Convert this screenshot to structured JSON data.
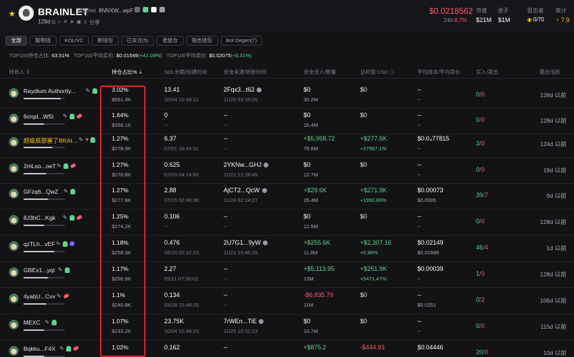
{
  "header": {
    "token_name": "BRAINLET",
    "token_sub": "Brainlet",
    "contract": "8NNXW...wpF",
    "age": "128d",
    "share_label": "分享",
    "price": "$0.0218562",
    "change_label": "24h",
    "change_value": "-8.7%",
    "stats": [
      {
        "label": "市值",
        "value": "$21M"
      },
      {
        "label": "池子",
        "value": "$1M"
      },
      {
        "label": "狙击者",
        "value": "0/70"
      },
      {
        "label": "审计",
        "value": "7.9"
      }
    ],
    "colors": {
      "accent": "#f5c518",
      "up": "#5fd38d",
      "down": "#ff5a6a"
    }
  },
  "tabs": [
    {
      "label": "全部",
      "active": true
    },
    {
      "label": "聪明钱"
    },
    {
      "label": "KOL/VC"
    },
    {
      "label": "新钱包"
    },
    {
      "label": "已关注(5)"
    },
    {
      "label": "老鼠仓"
    },
    {
      "label": "狙击钱包"
    },
    {
      "label": "Bot Degen(7)"
    }
  ],
  "top100": {
    "hold_label": "TOP100持仓占比:",
    "hold_value": "63.51%",
    "buy_label": "TOP100平均买价:",
    "buy_value": "$0.01549",
    "buy_change": "(+41.09%)",
    "sell_label": "TOP100平均卖价:",
    "sell_value": "$0.02075",
    "sell_change": "(+5.31%)"
  },
  "columns": {
    "holder": "持有人",
    "pct": "持仓占比%",
    "sol": "SOL余额/创建时间",
    "source": "资金来源/转账时间",
    "flow": "资金流入/数量",
    "pnl": "总利润 USD",
    "cost": "平均成本/平均卖价",
    "tx": "买入/卖出",
    "last": "最后活跃"
  },
  "rows": [
    {
      "name": "Raydium Authority...",
      "yellow": false,
      "bar": 0.9,
      "pct": "3.02%",
      "pct_sub": "$661.3K",
      "sol": "13.41",
      "sol_sub": "10/04 22:48:12",
      "src": "2Fqx3...t62",
      "src_sub": "11/25 03:16:05",
      "flow": "$0",
      "flow_sub": "30.2M",
      "flow_cls": "",
      "pnl": "$0",
      "pnl_sub": "",
      "pnl_cls": "",
      "cost": "--",
      "cost_sub": "--",
      "buy": "0",
      "sell": "0",
      "last": "128d 以前"
    },
    {
      "name": "6crqd...W5t",
      "yellow": false,
      "bar": 0.5,
      "pct": "1.64%",
      "pct_sub": "$358.1K",
      "sol": "0",
      "sol_sub": "--",
      "src": "--",
      "src_sub": "--",
      "flow": "$0",
      "flow_sub": "16.4M",
      "flow_cls": "",
      "pnl": "$0",
      "pnl_sub": "",
      "pnl_cls": "",
      "cost": "--",
      "cost_sub": "--",
      "buy": "0",
      "sell": "0",
      "last": "128d 以前"
    },
    {
      "name": "超级底部塞了BRAI...",
      "yellow": true,
      "bar": 0.7,
      "pct": "1.27%",
      "pct_sub": "$278.9K",
      "sol": "6.37",
      "sol_sub": "07/01 16:44:31",
      "src": "--",
      "src_sub": "--",
      "flow": "+$5,958.72",
      "flow_sub": "76.6M",
      "flow_cls": "g",
      "pnl": "+$277.5K",
      "pnl_sub": "+27987.1%",
      "pnl_cls": "g",
      "cost": "$0.0₄77815",
      "cost_sub": "--",
      "buy": "3",
      "sell": "0",
      "last": "124d 以前"
    },
    {
      "name": "2mLso...oeT",
      "yellow": false,
      "bar": 0.55,
      "pct": "1.27%",
      "pct_sub": "$278.8K",
      "sol": "0.625",
      "sol_sub": "07/03 04:14:50",
      "src": "2YKNw...GHJ",
      "src_sub": "11/21 12:28:45",
      "flow": "$0",
      "flow_sub": "12.7M",
      "flow_cls": "",
      "pnl": "$0",
      "pnl_sub": "",
      "pnl_cls": "",
      "cost": "--",
      "cost_sub": "--",
      "buy": "0",
      "sell": "0",
      "last": "19d 以前"
    },
    {
      "name": "GFzq6...QwZ",
      "yellow": false,
      "bar": 0.6,
      "pct": "1.27%",
      "pct_sub": "$277.8K",
      "sol": "2.88",
      "sol_sub": "07/15 02:48:36",
      "src": "AjCT2...QcW",
      "src_sub": "11/24 02:24:27",
      "flow": "+$29.6K",
      "flow_sub": "35.4M",
      "flow_cls": "g",
      "pnl": "+$271.9K",
      "pnl_sub": "+1950.89%",
      "pnl_cls": "g",
      "cost": "$0.00073",
      "cost_sub": "$0.0005",
      "buy": "39",
      "sell": "7",
      "last": "9d 以前"
    },
    {
      "name": "8J3hC...Kgk",
      "yellow": false,
      "bar": 0.5,
      "pct": "1.25%",
      "pct_sub": "$274.2K",
      "sol": "0.106",
      "sol_sub": "--",
      "src": "--",
      "src_sub": "--",
      "flow": "$0",
      "flow_sub": "12.5M",
      "flow_cls": "",
      "pnl": "$0",
      "pnl_sub": "",
      "pnl_cls": "",
      "cost": "--",
      "cost_sub": "--",
      "buy": "0",
      "sell": "0",
      "last": "128d 以前"
    },
    {
      "name": "qzTLh...vEF",
      "yellow": false,
      "bar": 0.75,
      "pct": "1.18%",
      "pct_sub": "$258.3K",
      "sol": "0.476",
      "sol_sub": "08/20 02:32:23",
      "src": "2U7G1...9yW",
      "src_sub": "11/21 10:46:25",
      "flow": "+$255.6K",
      "flow_sub": "11.8M",
      "flow_cls": "g",
      "pnl": "+$2,307.16",
      "pnl_sub": "+0.88%",
      "pnl_cls": "g",
      "cost": "$0.02149",
      "cost_sub": "$0.01686",
      "buy": "46",
      "sell": "4",
      "last": "1d 以前"
    },
    {
      "name": "GBEx1...yqt",
      "yellow": false,
      "bar": 0.6,
      "pct": "1.17%",
      "pct_sub": "$256.9K",
      "sol": "2.27",
      "sol_sub": "05/11 07:38:02",
      "src": "--",
      "src_sub": "--",
      "flow": "+$5,113.95",
      "flow_sub": "13M",
      "flow_cls": "g",
      "pnl": "+$251.9K",
      "pnl_sub": "+5471.47%",
      "pnl_cls": "g",
      "cost": "$0.00039",
      "cost_sub": "--",
      "buy": "1",
      "sell": "0",
      "last": "128d 以前"
    },
    {
      "name": "4yabU...Cvv",
      "yellow": false,
      "bar": 0.55,
      "pct": "1.1%",
      "pct_sub": "$240.8K",
      "sol": "0.134",
      "sol_sub": "03/28 22:48:26",
      "src": "--",
      "src_sub": "--",
      "flow": "-$6,835.79",
      "flow_sub": "11M",
      "flow_cls": "r",
      "pnl": "$0",
      "pnl_sub": "",
      "pnl_cls": "",
      "cost": "--",
      "cost_sub": "$0.0251",
      "buy": "0",
      "sell": "2",
      "last": "106d 以前"
    },
    {
      "name": "MEXC",
      "yellow": false,
      "bar": 0.5,
      "pct": "1.07%",
      "pct_sub": "$233.2K",
      "sol": "23.75K",
      "sol_sub": "10/04 22:48:23",
      "src": "7rWEn...TiE",
      "src_sub": "11/25 10:31:23",
      "flow": "$0",
      "flow_sub": "10.7M",
      "flow_cls": "",
      "pnl": "$0",
      "pnl_sub": "",
      "pnl_cls": "",
      "cost": "--",
      "cost_sub": "--",
      "buy": "0",
      "sell": "0",
      "last": "115d 以前"
    },
    {
      "name": "Bqkku...F4X",
      "yellow": false,
      "bar": 0.5,
      "pct": "1.02%",
      "pct_sub": "",
      "sol": "0.162",
      "sol_sub": "",
      "src": "--",
      "src_sub": "",
      "flow": "+$875.2",
      "flow_sub": "",
      "flow_cls": "g",
      "pnl": "-$444.93",
      "pnl_sub": "",
      "pnl_cls": "r",
      "cost": "$0.04446",
      "cost_sub": "",
      "buy": "20",
      "sell": "0",
      "last": "10d 以前"
    }
  ]
}
